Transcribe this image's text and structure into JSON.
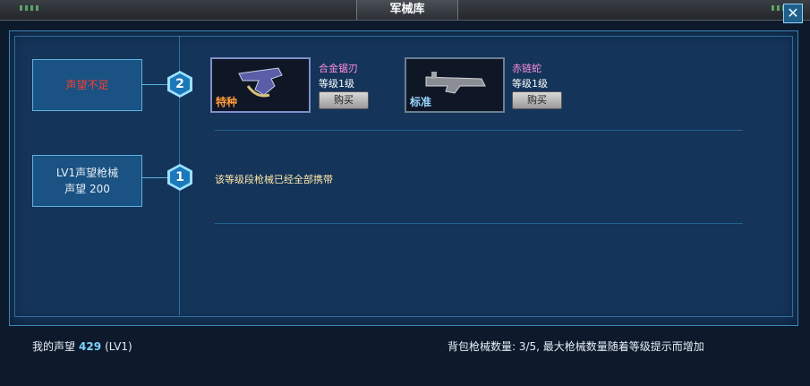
{
  "window": {
    "title": "军械库"
  },
  "tiers": [
    {
      "number": "2",
      "requirement": "声望不足",
      "items": [
        {
          "name": "合金锯刃",
          "level": "等级1级",
          "tag": "特种",
          "tag_color": "#ff9c3a",
          "buy_label": "购买"
        },
        {
          "name": "赤链蛇",
          "level": "等级1级",
          "tag": "标准",
          "tag_color": "#9ad7ff",
          "buy_label": "购买"
        }
      ]
    },
    {
      "number": "1",
      "requirement_line1": "LV1声望枪械",
      "requirement_line2": "声望 200",
      "note": "该等级段枪械已经全部携带"
    }
  ],
  "footer": {
    "reputation_label": "我的声望",
    "reputation_value": "429",
    "reputation_level": "(LV1)",
    "bag_info": "背包枪械数量: 3/5, 最大枪械数量随着等级提示而增加"
  },
  "colors": {
    "accent": "#3aa2d6",
    "warning": "#ff3c2c",
    "item_name": "#ff8fd8"
  },
  "icons": {
    "close": "close-icon"
  }
}
